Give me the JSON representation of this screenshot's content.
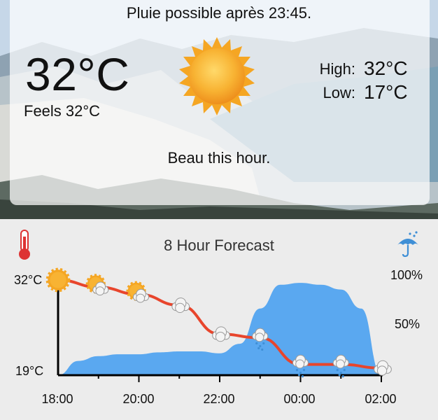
{
  "current": {
    "alert": "Pluie possible après 23:45.",
    "temperature": "32°C",
    "feels_like": "Feels 32°C",
    "high_label": "High:",
    "high_value": "32°C",
    "low_label": "Low:",
    "low_value": "17°C",
    "summary": "Beau this hour.",
    "condition_icon": "sun-icon"
  },
  "forecast": {
    "title": "8 Hour Forecast",
    "temp_icon": "thermometer-icon",
    "precip_icon": "umbrella-rain-icon"
  },
  "chart_data": {
    "type": "line",
    "x": [
      "18:00",
      "18:30",
      "19:00",
      "19:30",
      "20:00",
      "20:30",
      "21:00",
      "21:30",
      "22:00",
      "22:30",
      "23:00",
      "23:30",
      "00:00",
      "00:30",
      "01:00",
      "01:30",
      "02:00"
    ],
    "xticks": [
      "18:00",
      "20:00",
      "22:00",
      "00:00",
      "02:00"
    ],
    "temperature": {
      "ylim": [
        19,
        32
      ],
      "ytick_labels": [
        "32°C",
        "19°C"
      ],
      "points": [
        {
          "x": "18:00",
          "y": 32,
          "icon": "sun-icon"
        },
        {
          "x": "19:00",
          "y": 31,
          "icon": "sun-cloud-icon"
        },
        {
          "x": "20:00",
          "y": 30,
          "icon": "sun-cloud-icon"
        },
        {
          "x": "21:00",
          "y": 28.5,
          "icon": "cloud-icon"
        },
        {
          "x": "22:00",
          "y": 24.5,
          "icon": "cloud-icon"
        },
        {
          "x": "23:00",
          "y": 24,
          "icon": "rain-cloud-icon"
        },
        {
          "x": "00:00",
          "y": 20.3,
          "icon": "rain-cloud-icon"
        },
        {
          "x": "01:00",
          "y": 20.3,
          "icon": "rain-cloud-icon"
        },
        {
          "x": "02:00",
          "y": 19.8,
          "icon": "cloud-icon"
        }
      ]
    },
    "precipitation": {
      "ylim": [
        0,
        100
      ],
      "tick_labels": [
        "100%",
        "50%"
      ],
      "values": [
        0,
        15,
        20,
        22,
        22,
        24,
        25,
        25,
        23,
        33,
        70,
        95,
        97,
        95,
        90,
        70,
        0
      ]
    },
    "colors": {
      "temperature_line": "#e8452c",
      "precip_area": "#5aa8f0",
      "axis": "#000000"
    }
  }
}
